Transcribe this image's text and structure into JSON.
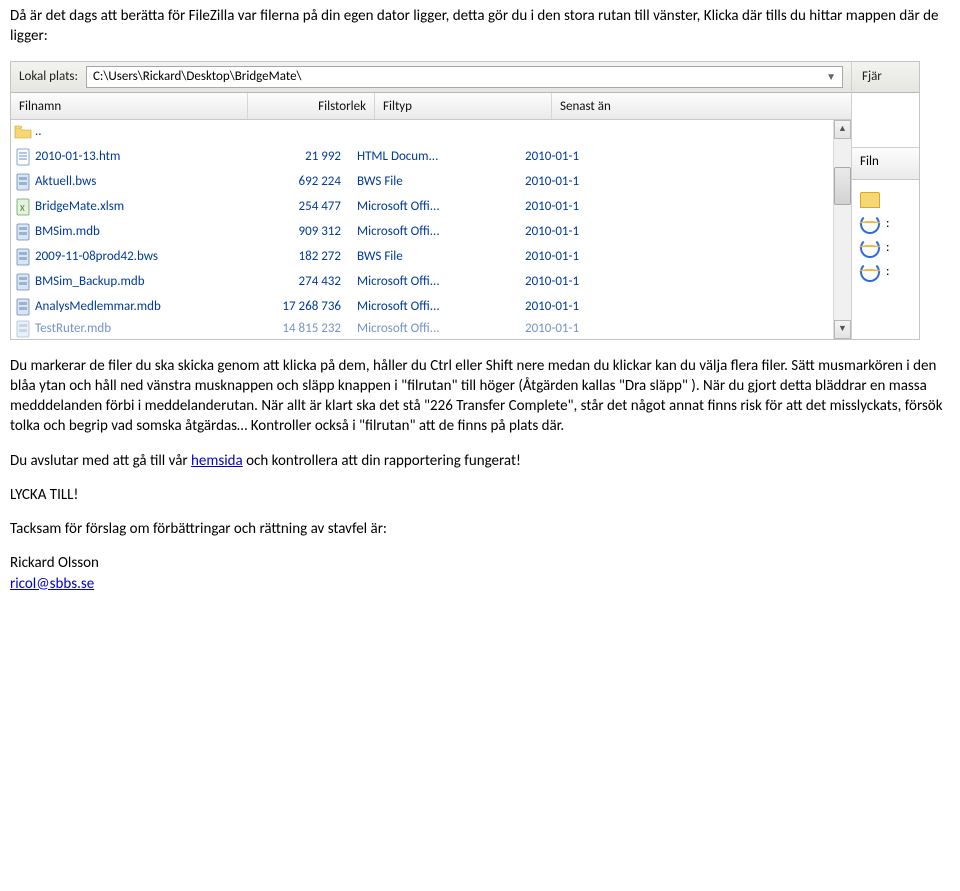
{
  "para_intro": "Då är det dags att berätta för FileZilla var filerna på din egen dator ligger, detta gör du i den stora rutan till vänster, Klicka där tills du hittar mappen där de ligger:",
  "screenshot": {
    "addr_label_left": "Lokal plats:",
    "addr_value": "C:\\Users\\Rickard\\Desktop\\BridgeMate\\",
    "addr_label_right": "Fjär",
    "columns": {
      "name": "Filnamn",
      "size": "Filstorlek",
      "type": "Filtyp",
      "date": "Senast än"
    },
    "right_header": "Filn",
    "rows": [
      {
        "icon": "folder",
        "name": "..",
        "size": "",
        "type": "",
        "date": ""
      },
      {
        "icon": "doc",
        "name": "2010-01-13.htm",
        "size": "21 992",
        "type": "HTML Docum...",
        "date": "2010-01-1"
      },
      {
        "icon": "db",
        "name": "Aktuell.bws",
        "size": "692 224",
        "type": "BWS File",
        "date": "2010-01-1"
      },
      {
        "icon": "xl",
        "name": "BridgeMate.xlsm",
        "size": "254 477",
        "type": "Microsoft Offi...",
        "date": "2010-01-1"
      },
      {
        "icon": "db",
        "name": "BMSim.mdb",
        "size": "909 312",
        "type": "Microsoft Offi...",
        "date": "2010-01-1"
      },
      {
        "icon": "db",
        "name": "2009-11-08prod42.bws",
        "size": "182 272",
        "type": "BWS File",
        "date": "2010-01-1"
      },
      {
        "icon": "db",
        "name": "BMSim_Backup.mdb",
        "size": "274 432",
        "type": "Microsoft Offi...",
        "date": "2010-01-1"
      },
      {
        "icon": "db",
        "name": "AnalysMedlemmar.mdb",
        "size": "17 268 736",
        "type": "Microsoft Offi...",
        "date": "2010-01-1"
      },
      {
        "icon": "db",
        "name": "TestRuter.mdb",
        "size": "14 815 232",
        "type": "Microsoft Offi...",
        "date": "2010-01-1",
        "last": true
      }
    ],
    "right_items": [
      {
        "kind": "folder"
      },
      {
        "kind": "ie",
        "label": ":"
      },
      {
        "kind": "ie",
        "label": ":"
      },
      {
        "kind": "ie",
        "label": ":"
      }
    ]
  },
  "para_mid": "Du markerar de filer du ska skicka genom att klicka på dem, håller du Ctrl eller Shift nere medan du klickar kan du välja flera filer. Sätt musmarkören i den blåa ytan och håll ned vänstra musknappen och släpp knappen i \"filrutan\" till höger (Åtgärden kallas \"Dra släpp\" ). När du gjort detta bläddrar en massa medddelanden förbi i meddelanderutan. När allt är klart ska det stå \"226 Transfer Complete\", står det något annat finns risk för att det misslyckats, försök tolka och begrip vad somska åtgärdas… Kontroller också i \"filrutan\" att de finns på plats där.",
  "para_end_pre": "Du avslutar med att gå till vår ",
  "link_hemsida": "hemsida",
  "para_end_post": " och kontrollera att din rapportering fungerat!",
  "lycka": "LYCKA TILL!",
  "thanks": "Tacksam för förslag om förbättringar och rättning av stavfel är:",
  "author": "Rickard Olsson",
  "email": "ricol@sbbs.se"
}
